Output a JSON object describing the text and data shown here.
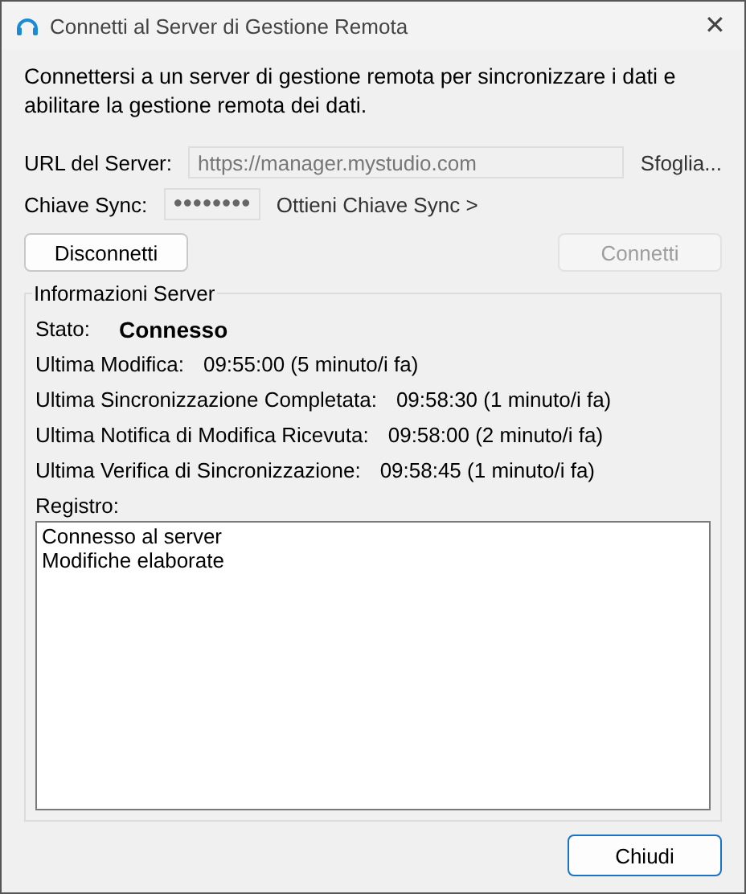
{
  "window": {
    "title": "Connetti al Server di Gestione Remota",
    "close": "✕"
  },
  "description": "Connettersi a un server di gestione remota per sincronizzare i dati e abilitare la gestione remota dei dati.",
  "fields": [
    {
      "kind": "text",
      "label": "URL del Server:",
      "value": "https://manager.mystudio.com",
      "disabled": true,
      "link": "Sfoglia..."
    },
    {
      "kind": "password",
      "label": "Chiave Sync:",
      "value": "●●●●●●●●",
      "disabled": true,
      "link": "Ottieni Chiave Sync >"
    }
  ],
  "actions": [
    {
      "label": "Disconnetti",
      "disabled": false
    },
    {
      "label": "Connetti",
      "disabled": true
    }
  ],
  "server_info": {
    "title": "Informazioni Server",
    "status": {
      "label": "Stato:",
      "value": "Connesso"
    },
    "rows": [
      {
        "label": "Ultima Modifica:",
        "value": "09:55:00 (5 minuto/i fa)"
      },
      {
        "label": "Ultima Sincronizzazione Completata:",
        "value": "09:58:30 (1 minuto/i fa)"
      },
      {
        "label": "Ultima Notifica di Modifica Ricevuta:",
        "value": "09:58:00 (2 minuto/i fa)"
      },
      {
        "label": "Ultima Verifica di Sincronizzazione:",
        "value": "09:58:45 (1 minuto/i fa)"
      }
    ],
    "log_label": "Registro:",
    "log": [
      "Connesso al server",
      "Modifiche elaborate"
    ]
  },
  "footer": {
    "label": "Chiudi",
    "default": true
  }
}
